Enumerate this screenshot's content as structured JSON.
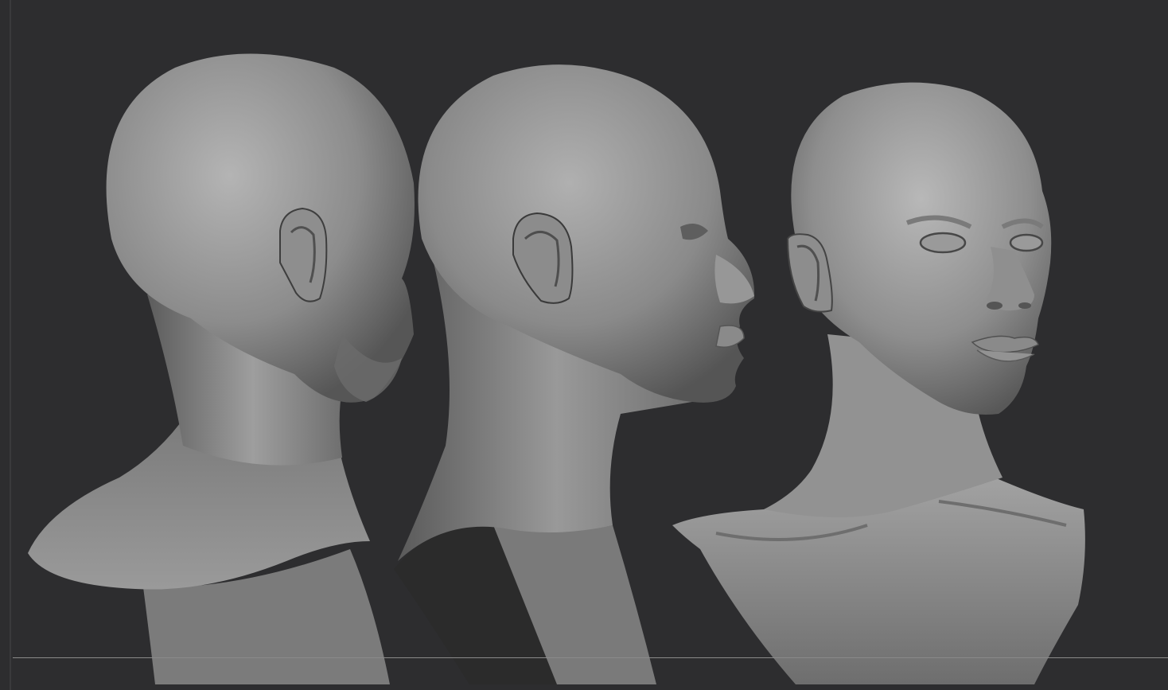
{
  "canvas": {
    "background_color": "#2d2d2f",
    "edge_color": "#3a3a3c",
    "floor_line_color": "#8a8a8a",
    "clay_color": "#8e8e8e",
    "clay_highlight": "#b8b8b8",
    "clay_shadow": "#4a4a4a"
  },
  "views": [
    {
      "name": "back-three-quarter-view"
    },
    {
      "name": "side-profile-view"
    },
    {
      "name": "front-three-quarter-view"
    }
  ]
}
